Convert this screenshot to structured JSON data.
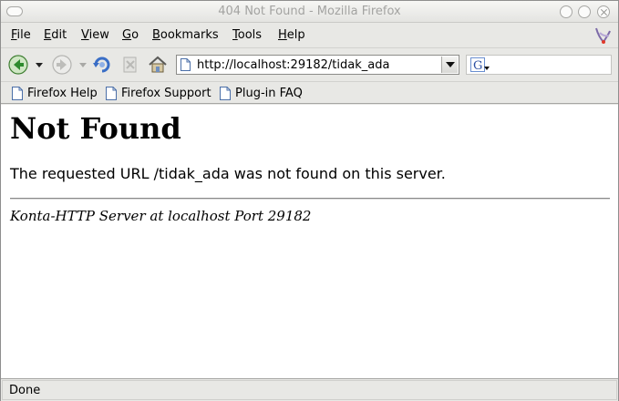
{
  "window": {
    "title": "404 Not Found - Mozilla Firefox"
  },
  "menu": [
    {
      "key": "F",
      "rest": "ile"
    },
    {
      "key": "E",
      "rest": "dit"
    },
    {
      "key": "V",
      "rest": "iew"
    },
    {
      "key": "G",
      "rest": "o"
    },
    {
      "key": "B",
      "rest": "ookmarks"
    },
    {
      "key": "T",
      "rest": "ools"
    },
    {
      "key": "H",
      "rest": "elp"
    }
  ],
  "toolbar": {
    "url": "http://localhost:29182/tidak_ada",
    "search_value": ""
  },
  "bookmarks": [
    {
      "label": "Firefox Help"
    },
    {
      "label": "Firefox Support"
    },
    {
      "label": "Plug-in FAQ"
    }
  ],
  "page": {
    "heading": "Not Found",
    "message": "The requested URL /tidak_ada was not found on this server.",
    "address": "Konta-HTTP Server at localhost Port 29182"
  },
  "status": {
    "text": "Done"
  },
  "colors": {
    "chrome": "#e8e8e5",
    "back_arrow_green": "#2e8b2e"
  }
}
